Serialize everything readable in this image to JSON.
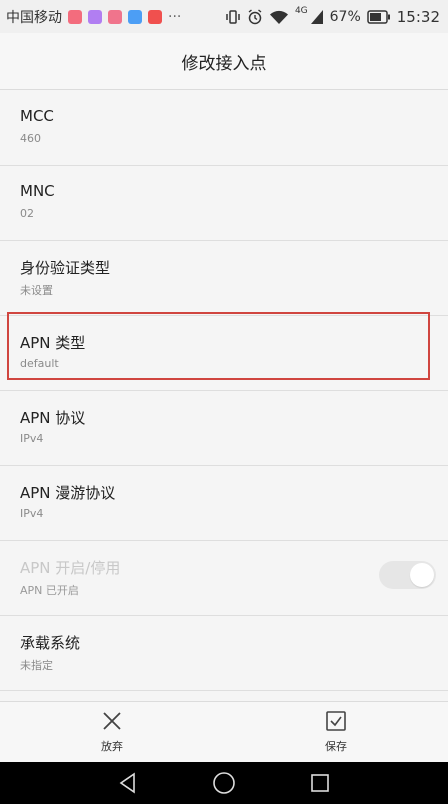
{
  "status_bar": {
    "carrier": "中国移动",
    "network": "4G",
    "battery": "67%",
    "time": "15:32",
    "app_icons": [
      {
        "name": "heart-app-icon",
        "color": "#f36c7d"
      },
      {
        "name": "purple-app-icon",
        "color": "#b17ef2"
      },
      {
        "name": "pink-app-icon",
        "color": "#f0748c"
      },
      {
        "name": "blue-app-icon",
        "color": "#4c9ef5"
      },
      {
        "name": "red-app-icon",
        "color": "#f0504e"
      }
    ]
  },
  "header": {
    "title": "修改接入点"
  },
  "settings": [
    {
      "title": "MCC",
      "value": "460"
    },
    {
      "title": "MNC",
      "value": "02"
    },
    {
      "title": "身份验证类型",
      "value": "未设置"
    },
    {
      "title": "APN 类型",
      "value": "default"
    },
    {
      "title": "APN 协议",
      "value": "IPv4"
    },
    {
      "title": "APN 漫游协议",
      "value": "IPv4"
    },
    {
      "title": "APN 开启/停用",
      "value": "APN 已开启"
    },
    {
      "title": "承载系统",
      "value": "未指定"
    }
  ],
  "bottom_bar": {
    "discard_label": "放弃",
    "save_label": "保存"
  },
  "colors": {
    "highlight": "#d0453f"
  }
}
